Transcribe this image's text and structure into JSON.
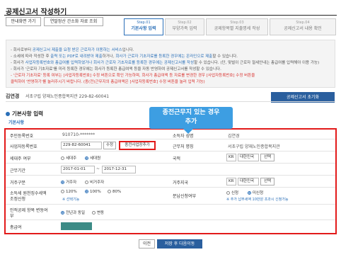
{
  "page": {
    "title": "공제신고서 작성하기"
  },
  "top_buttons": {
    "guide": "안내화면 가기",
    "inquiry": "연말정산 간소화 자료 조회"
  },
  "steps": [
    {
      "num": "Step.01",
      "label": "기본사항 입력"
    },
    {
      "num": "Step.02",
      "label": "부양가족 입력"
    },
    {
      "num": "Step.03",
      "label": "공제항목별 지출명세 작성"
    },
    {
      "num": "Step.04",
      "label": "공제신고서 내용 확인"
    }
  ],
  "notices": {
    "n1_pre": "- 회사로부터 ",
    "n1_hl": "공제신고서 제출을 요청 받은 근로자가 이용하는 서비스",
    "n1_post": "입니다.",
    "n2_pre": "- 소세에 따라 작성한 후 ",
    "n2_hl": "출력 또는 PDF로 내려받아 제출",
    "n2_mid": "하거나, ",
    "n2_hl2": "회사가 근로자 기초자료를 등록한 경우에는 온라인으로 제출",
    "n2_post": "할 수 있습니다.",
    "n3_pre": "- 회사가 ",
    "n3_hl": "사업자등록번호와 총급여를 입력하였거나 회사가 근로자 기초자료를 등록한 경우에는 공제신고서를 작성",
    "n3_post": "할 수 있습니다. (단, 맞벌이 근로자 절세안내는 총급여를 입력해야 이용 가능)",
    "n4": "- 회사가 '근로자 기초자료'를 미리 등록한 경우에는 회사가 등록한 총급여액 등을 자동 반영하여 공제신고서를 작성할 수 있습니다.",
    "n5": "- '근로자 기초자료' 등록 여부는 [사업자등록번호] 수정 버튼으로 확인 가능하며, 회사가 총급여액 등 자료를 변경한 경우 [사업자등록번호] 수정 버튼을",
    "n6": "  클릭하여 '반영하기'를 눌러주시기 바랍니다. (종(전)근무지의 총급여액은 [사업자등록번호] 수정 버튼을 눌러 입력 가능)"
  },
  "filer": {
    "label": "김연경",
    "value": "서초구립 양재노인종합복지관 229-82-60041",
    "reset_button": "공제신고서 초기화"
  },
  "section": {
    "title": "기본사항 입력",
    "subtitle": "기본사항"
  },
  "callout": {
    "line1": "종전근무지 있는 경우",
    "line2": "추가"
  },
  "form": {
    "rrn_label": "주민등록번호",
    "rrn_value": "910710-*******",
    "name_label": "소득자 성명",
    "name_value": "김연경",
    "bizno_label": "사업자등록번호",
    "bizno_value": "229-82-60041",
    "edit_button": "수정",
    "add_prev_button": "종전사업장추가",
    "workplace_label": "근무처 명칭",
    "workplace_value": "서초구립 양재노인종합복지관",
    "household_label": "세대주 여부",
    "household_opt1": "세대주",
    "household_opt2": "세대원",
    "nation_label": "국적",
    "nation_code": "KR",
    "nation_name": "대한민국",
    "nation_select": "선택",
    "period_label": "근무기간",
    "period_from": "2017-01-01",
    "period_to": "2017-12-31",
    "resident_label": "거주구분",
    "resident_opt1": "거주자",
    "resident_opt2": "비거주자",
    "country_label": "거주지국",
    "country_code": "KR",
    "country_name": "대한민국",
    "country_select": "선택",
    "withhold_label1": "소득세 원천징수세액",
    "withhold_label2": "조정신청",
    "withhold_opt1": "120%",
    "withhold_opt2": "100%",
    "withhold_opt3": "80%",
    "withhold_note": "※ 선택기능",
    "split_label": "분납신청여부",
    "split_opt1": "신청",
    "split_opt2": "미신청",
    "split_note": "※ 추가 납부세액 10만원 초과시 신청가능",
    "change_label1": "인적공제 항목 변동여",
    "change_label2": "부",
    "change_opt1": "전년과 동일",
    "change_opt2": "변동",
    "pay_label": "총급여"
  },
  "bottom": {
    "prev": "이전",
    "next": "저장 후 다음이동"
  }
}
